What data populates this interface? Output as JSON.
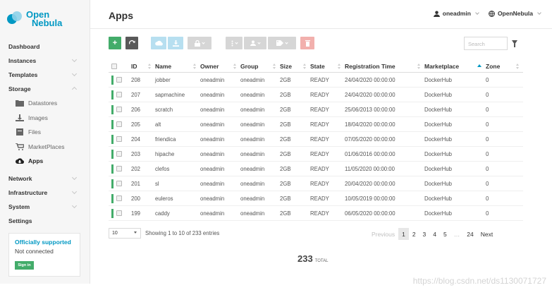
{
  "logo": {
    "line1": "Open",
    "line2": "Nebula"
  },
  "page_title": "Apps",
  "topbar": {
    "user": "oneadmin",
    "zone": "OpenNebula"
  },
  "nav": {
    "dashboard": "Dashboard",
    "instances": "Instances",
    "templates": "Templates",
    "storage": "Storage",
    "storage_items": [
      "Datastores",
      "Images",
      "Files",
      "MarketPlaces",
      "Apps"
    ],
    "network": "Network",
    "infrastructure": "Infrastructure",
    "system": "System",
    "settings": "Settings"
  },
  "support": {
    "title": "Officially supported",
    "status": "Not connected",
    "signin": "Sign in"
  },
  "toolbar": {
    "create_icon": "plus-icon",
    "refresh_icon": "refresh-icon"
  },
  "search": {
    "placeholder": "Search"
  },
  "table": {
    "headers": [
      "ID",
      "Name",
      "Owner",
      "Group",
      "Size",
      "State",
      "Registration Time",
      "Marketplace",
      "Zone"
    ],
    "rows": [
      [
        "208",
        "jobber",
        "oneadmin",
        "oneadmin",
        "2GB",
        "READY",
        "24/04/2020 00:00:00",
        "DockerHub",
        "0"
      ],
      [
        "207",
        "sapmachine",
        "oneadmin",
        "oneadmin",
        "2GB",
        "READY",
        "24/04/2020 00:00:00",
        "DockerHub",
        "0"
      ],
      [
        "206",
        "scratch",
        "oneadmin",
        "oneadmin",
        "2GB",
        "READY",
        "25/06/2013 00:00:00",
        "DockerHub",
        "0"
      ],
      [
        "205",
        "alt",
        "oneadmin",
        "oneadmin",
        "2GB",
        "READY",
        "18/04/2020 00:00:00",
        "DockerHub",
        "0"
      ],
      [
        "204",
        "friendica",
        "oneadmin",
        "oneadmin",
        "2GB",
        "READY",
        "07/05/2020 00:00:00",
        "DockerHub",
        "0"
      ],
      [
        "203",
        "hipache",
        "oneadmin",
        "oneadmin",
        "2GB",
        "READY",
        "01/06/2016 00:00:00",
        "DockerHub",
        "0"
      ],
      [
        "202",
        "clefos",
        "oneadmin",
        "oneadmin",
        "2GB",
        "READY",
        "11/05/2020 00:00:00",
        "DockerHub",
        "0"
      ],
      [
        "201",
        "sl",
        "oneadmin",
        "oneadmin",
        "2GB",
        "READY",
        "20/04/2020 00:00:00",
        "DockerHub",
        "0"
      ],
      [
        "200",
        "euleros",
        "oneadmin",
        "oneadmin",
        "2GB",
        "READY",
        "10/05/2019 00:00:00",
        "DockerHub",
        "0"
      ],
      [
        "199",
        "caddy",
        "oneadmin",
        "oneadmin",
        "2GB",
        "READY",
        "06/05/2020 00:00:00",
        "DockerHub",
        "0"
      ]
    ]
  },
  "footer": {
    "page_length": "10",
    "showing": "Showing 1 to 10 of 233 entries",
    "previous": "Previous",
    "pages": [
      "1",
      "2",
      "3",
      "4",
      "5"
    ],
    "ellipsis": "…",
    "last_page": "24",
    "next": "Next",
    "total_count": "233",
    "total_label": "TOTAL"
  },
  "watermark": "https://blog.csdn.net/ds1130071727",
  "colors": {
    "accent": "#0098c3",
    "ready": "#43ac6a",
    "delete": "#f2b0ad"
  }
}
